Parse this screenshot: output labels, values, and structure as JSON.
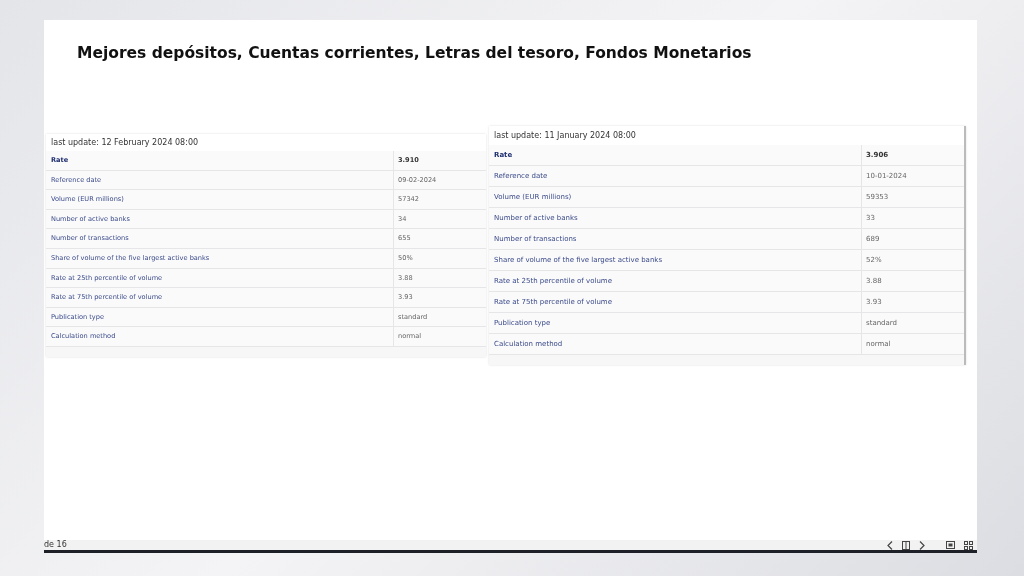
{
  "slide": {
    "title": "Mejores depósitos, Cuentas corrientes, Letras del tesoro, Fondos Monetarios"
  },
  "tables": [
    {
      "caption": "last update: 12 February 2024 08:00",
      "rows": [
        {
          "label": "Rate",
          "value": "3.910",
          "bold": true
        },
        {
          "label": "Reference date",
          "value": "09-02-2024",
          "bold": false
        },
        {
          "label": "Volume (EUR millions)",
          "value": "57342",
          "bold": false
        },
        {
          "label": "Number of active banks",
          "value": "34",
          "bold": false
        },
        {
          "label": "Number of transactions",
          "value": "655",
          "bold": false
        },
        {
          "label": "Share of volume of the five largest active banks",
          "value": "50%",
          "bold": false
        },
        {
          "label": "Rate at 25th percentile of volume",
          "value": "3.88",
          "bold": false
        },
        {
          "label": "Rate at 75th percentile of volume",
          "value": "3.93",
          "bold": false
        },
        {
          "label": "Publication type",
          "value": "standard",
          "bold": false
        },
        {
          "label": "Calculation method",
          "value": "normal",
          "bold": false
        }
      ]
    },
    {
      "caption": "last update: 11 January 2024 08:00",
      "rows": [
        {
          "label": "Rate",
          "value": "3.906",
          "bold": true
        },
        {
          "label": "Reference date",
          "value": "10-01-2024",
          "bold": false
        },
        {
          "label": "Volume (EUR millions)",
          "value": "59353",
          "bold": false
        },
        {
          "label": "Number of active banks",
          "value": "33",
          "bold": false
        },
        {
          "label": "Number of transactions",
          "value": "689",
          "bold": false
        },
        {
          "label": "Share of volume of the five largest active banks",
          "value": "52%",
          "bold": false
        },
        {
          "label": "Rate at 25th percentile of volume",
          "value": "3.88",
          "bold": false
        },
        {
          "label": "Rate at 75th percentile of volume",
          "value": "3.93",
          "bold": false
        },
        {
          "label": "Publication type",
          "value": "standard",
          "bold": false
        },
        {
          "label": "Calculation method",
          "value": "normal",
          "bold": false
        }
      ]
    }
  ],
  "footer": {
    "page_text": "de 16"
  }
}
